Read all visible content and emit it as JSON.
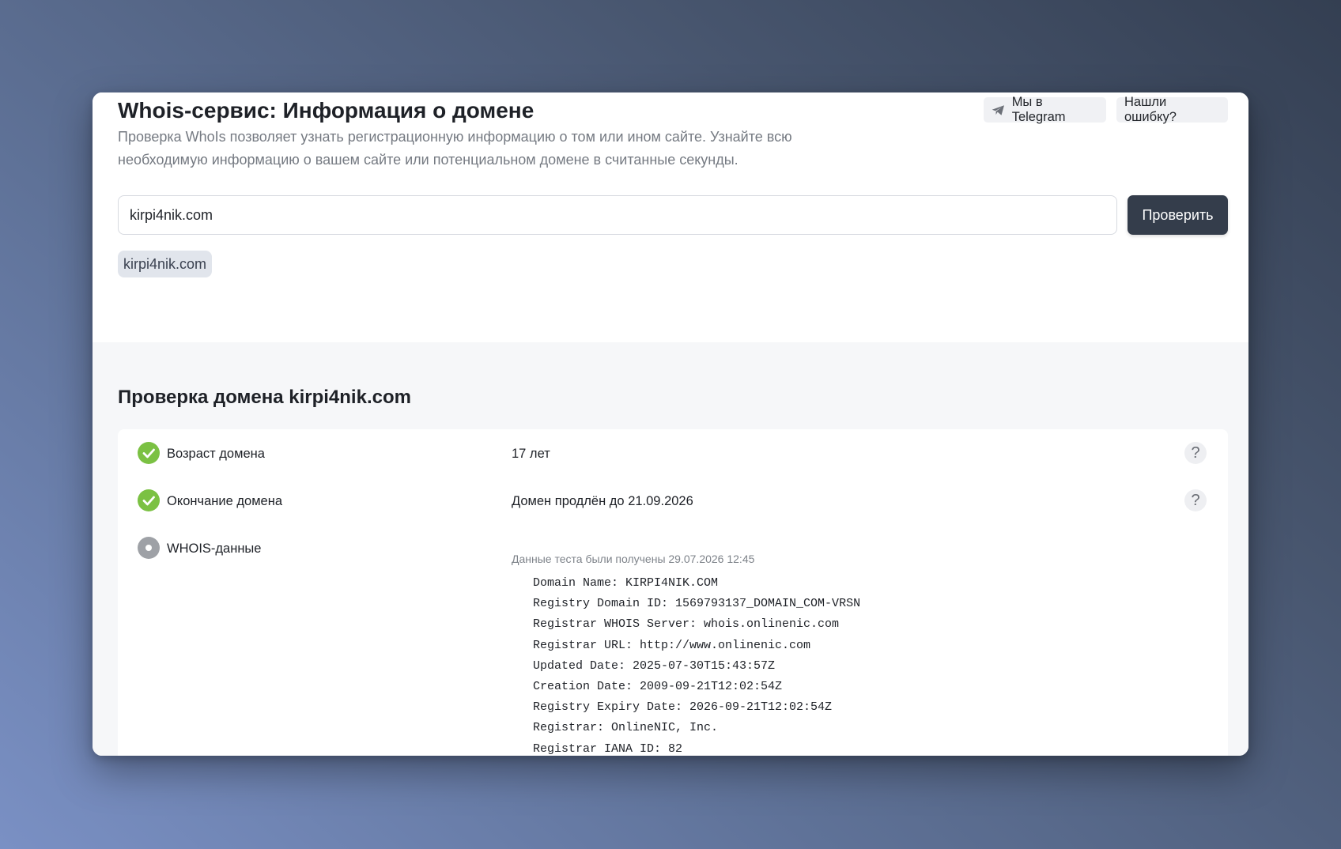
{
  "header": {
    "title": "Whois-сервис: Информация о домене",
    "description": "Проверка WhoIs позволяет узнать регистрационную информацию о том или ином сайте. Узнайте всю необходимую информацию о вашем сайте или потенциальном домене в считанные секунды.",
    "telegram_label": "Мы в Telegram",
    "report_error_label": "Нашли ошибку?"
  },
  "search": {
    "value": "kirpi4nik.com",
    "button_label": "Проверить",
    "history_chip": "kirpi4nik.com"
  },
  "results": {
    "title": "Проверка домена kirpi4nik.com",
    "rows": [
      {
        "label": "Возраст домена",
        "value": "17 лет",
        "status": "ok"
      },
      {
        "label": "Окончание домена",
        "value": "Домен продлён до 21.09.2026",
        "status": "ok"
      },
      {
        "label": "WHOIS-данные",
        "status": "neutral"
      }
    ],
    "help_glyph": "?",
    "whois": {
      "note": "Данные теста были получены 29.07.2026 12:45",
      "lines": [
        "Domain Name: KIRPI4NIK.COM",
        "Registry Domain ID: 1569793137_DOMAIN_COM-VRSN",
        "Registrar WHOIS Server: whois.onlinenic.com",
        "Registrar URL: http://www.onlinenic.com",
        "Updated Date: 2025-07-30T15:43:57Z",
        "Creation Date: 2009-09-21T12:02:54Z",
        "Registry Expiry Date: 2026-09-21T12:02:54Z",
        "Registrar: OnlineNIC, Inc.",
        "Registrar IANA ID: 82"
      ]
    }
  },
  "icons": {
    "telegram": "paper-plane-icon",
    "status_ok": "check-circle-icon",
    "status_neutral": "dot-circle-icon",
    "help": "question-icon"
  },
  "colors": {
    "primary_button": "#343d4b",
    "ok_green": "#7bc143",
    "neutral_gray": "#9ea1a6"
  }
}
